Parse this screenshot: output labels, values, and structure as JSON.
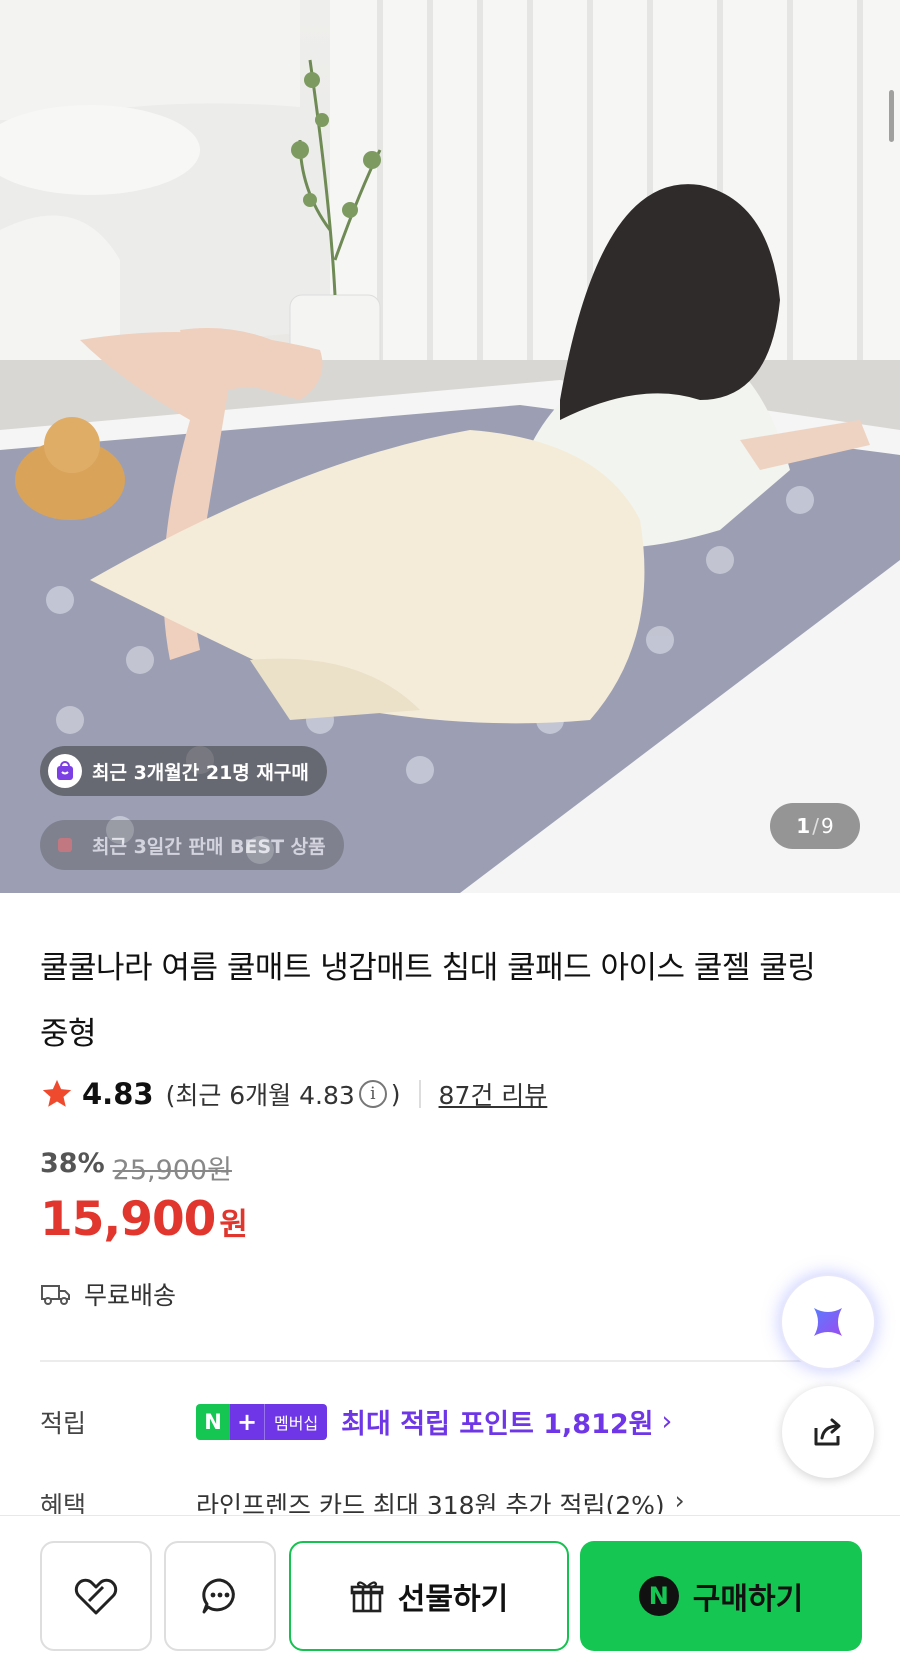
{
  "hero": {
    "repurchase_chip": "최근 3개월간 21명 재구매",
    "best_chip": "최근 3일간 판매 BEST 상품",
    "image_index": "1",
    "image_total": "9"
  },
  "product": {
    "title": "쿨쿨나라 여름 쿨매트 냉감매트 침대 쿨패드 아이스 쿨젤 쿨링 중형",
    "rating": "4.83",
    "recent_rating_prefix": "(최근 6개월 4.83",
    "recent_rating_suffix": ")",
    "review_link": "87건 리뷰",
    "discount_rate": "38%",
    "original_price": "25,900원",
    "price": "15,900",
    "currency": "원",
    "shipping": "무료배송"
  },
  "points": {
    "label": "적립",
    "badge_n": "N",
    "badge_plus": "+",
    "badge_membership": "멤버십",
    "text": "최대 적립 포인트 1,812원",
    "chevron": "›"
  },
  "benefit": {
    "label": "혜택",
    "text": "라인프렌즈 카드 최대 318원 추가 적립(2%)",
    "chevron": "›"
  },
  "bottom_bar": {
    "gift_label": "선물하기",
    "buy_label": "구매하기",
    "npay_letter": "N"
  },
  "icons": {
    "star": "star-icon",
    "info": "info-icon",
    "truck": "truck-icon",
    "ai": "ai-assistant-icon",
    "share": "share-icon",
    "heart": "heart-icon",
    "chat": "chat-icon",
    "gift": "gift-icon"
  },
  "colors": {
    "price_red": "#e0362e",
    "naver_green": "#16c653",
    "membership_purple": "#6e36e6"
  }
}
